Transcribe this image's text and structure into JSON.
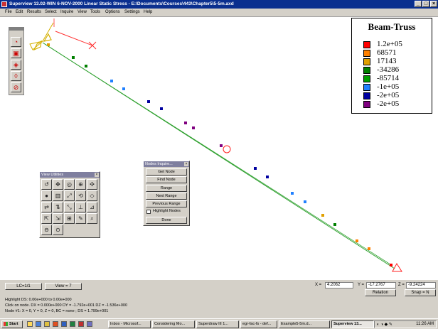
{
  "window": {
    "title": "Superview 13.02-WIN 6-NOV-2000 Linear Static Stress - E:\\Documents\\Courses\\443\\Chapter5\\5-5m.axd"
  },
  "menu": [
    "File",
    "Edit",
    "Results",
    "Select",
    "Inquire",
    "View",
    "Tools",
    "Options",
    "Settings",
    "Help"
  ],
  "legend": {
    "title": "Beam-Truss",
    "entries": [
      {
        "value": "1.2e+05",
        "color": "#ff0000"
      },
      {
        "value": "68571",
        "color": "#ff8000"
      },
      {
        "value": "17143",
        "color": "#e0a000"
      },
      {
        "value": "-34286",
        "color": "#008000"
      },
      {
        "value": "-85714",
        "color": "#00a000"
      },
      {
        "value": "-1e+05",
        "color": "#2080ff"
      },
      {
        "value": "-2e+05",
        "color": "#0000a0"
      },
      {
        "value": "-2e+05",
        "color": "#800080"
      }
    ]
  },
  "view_utilities": {
    "title": "View Utilities"
  },
  "nodes_dialog": {
    "title": "Nodes Inquire...",
    "buttons": [
      "Get Node",
      "Find Node",
      "Range",
      "Next Range",
      "Previous Range"
    ],
    "checkbox_label": "Highlight Nodes",
    "done_label": "Done"
  },
  "bottom": {
    "lc_label": "LC=1/1",
    "view_label": "View = 7",
    "x_label": "X =",
    "x_value": "4.2062",
    "y_label": "Y =",
    "y_value": "-17.2767",
    "z_label": "Z =",
    "z_value": "-9.24224",
    "relation_label": "Relation",
    "snap_label": "Snap = N",
    "status_lines": [
      "Highlight DS: 0.00e+000 to 0.00e+000",
      "Click on node.     DX = 0.000e+000 DY = -1.792e+001 DZ = -1.536e+000",
      "Node #1: X = 0, Y = 0, Z = 0, BC = none  ; DS = 1.799e+001"
    ]
  },
  "taskbar": {
    "start_label": "Start",
    "tasks": [
      {
        "label": "Inbox - Microsof...",
        "active": false
      },
      {
        "label": "Considering Mo...",
        "active": false
      },
      {
        "label": "Superdraw III 1...",
        "active": false
      },
      {
        "label": "egr-fac-fs - def...",
        "active": false
      },
      {
        "label": "Example5-5m.d...",
        "active": false
      },
      {
        "label": "Superview 13...",
        "active": true
      }
    ],
    "clock": "11:26 AM"
  }
}
